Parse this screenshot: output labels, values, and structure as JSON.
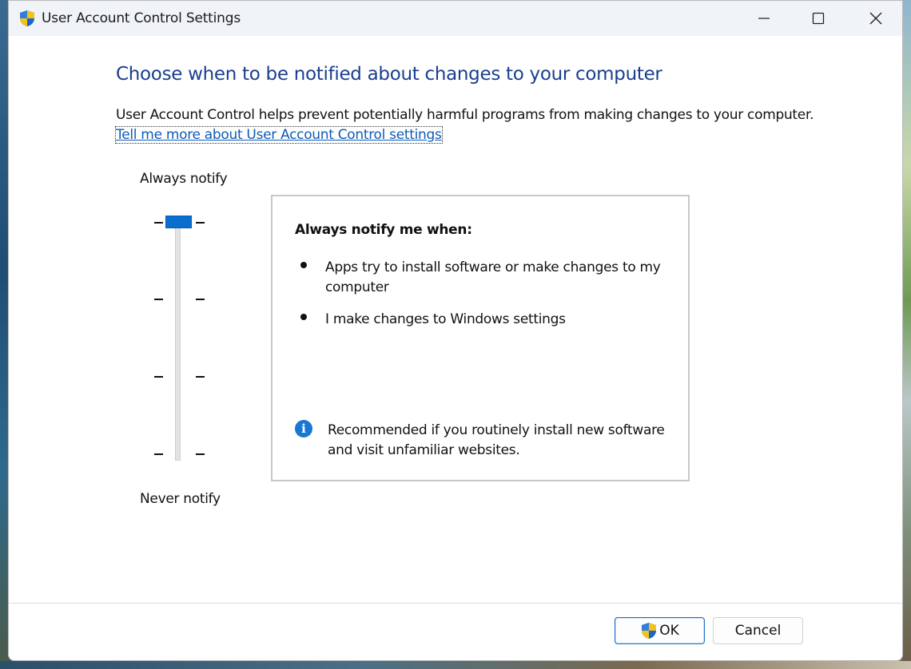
{
  "window": {
    "title": "User Account Control Settings",
    "title_icon": "uac-shield-icon",
    "controls": [
      "minimize-icon",
      "maximize-icon",
      "close-icon"
    ]
  },
  "main": {
    "heading": "Choose when to be notified about changes to your computer",
    "description": "User Account Control helps prevent potentially harmful programs from making changes to your computer.",
    "link_text": "Tell me more about User Account Control settings"
  },
  "slider": {
    "top_label": "Always notify",
    "bottom_label": "Never notify",
    "levels": 4,
    "selected_level": 4
  },
  "info_box": {
    "heading": "Always notify me when:",
    "bullets": [
      "Apps try to install software or make changes to my computer",
      "I make changes to Windows settings"
    ],
    "recommendation": "Recommended if you routinely install new software and visit unfamiliar websites."
  },
  "buttons": {
    "ok_label": "OK",
    "cancel_label": "Cancel"
  },
  "colors": {
    "heading_blue": "#1a3e8f",
    "link_blue": "#0d5bb8",
    "slider_thumb": "#0a6ecf",
    "info_icon": "#1877d2"
  }
}
